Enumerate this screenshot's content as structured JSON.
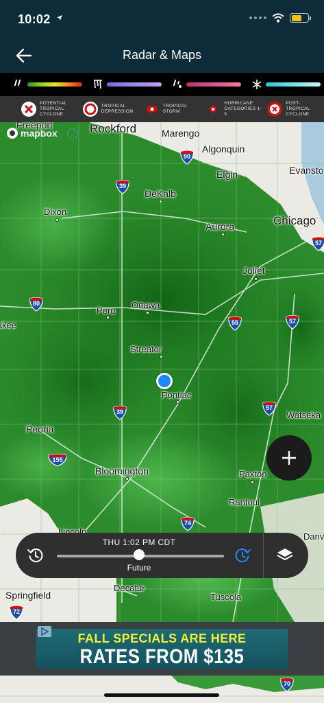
{
  "status_bar": {
    "time": "10:02"
  },
  "header": {
    "title": "Radar & Maps"
  },
  "precip_legend": {
    "items": [
      {
        "icon": "rain-icon",
        "colors": [
          "#1e9e1e",
          "#e8e82a",
          "#e02020"
        ]
      },
      {
        "icon": "ice-icon",
        "colors": [
          "#7a6cd6",
          "#c0a0f0"
        ]
      },
      {
        "icon": "mix-icon",
        "colors": [
          "#c03070",
          "#f07aa8"
        ]
      },
      {
        "icon": "snow-icon",
        "colors": [
          "#28c7d6",
          "#c8f6fa"
        ]
      }
    ]
  },
  "storm_legend": {
    "items": [
      {
        "icon": "potential-tropical-cyclone-icon",
        "label": "Potential Tropical Cyclone"
      },
      {
        "icon": "tropical-depression-icon",
        "label": "Tropical Depression"
      },
      {
        "icon": "tropical-storm-icon",
        "label": "Tropical Storm"
      },
      {
        "icon": "hurricane-icon",
        "label": "Hurricane Categories 1-5"
      },
      {
        "icon": "post-tropical-cyclone-icon",
        "label": "Post-Tropical Cyclone"
      }
    ]
  },
  "map": {
    "attribution": "mapbox",
    "cities": [
      {
        "name": "Freeport"
      },
      {
        "name": "Rockford"
      },
      {
        "name": "Marengo"
      },
      {
        "name": "Algonquin"
      },
      {
        "name": "Elgin"
      },
      {
        "name": "Evanston"
      },
      {
        "name": "DeKalb"
      },
      {
        "name": "Dixon"
      },
      {
        "name": "Aurora"
      },
      {
        "name": "Chicago"
      },
      {
        "name": "Joliet"
      },
      {
        "name": "Ottawa"
      },
      {
        "name": "Peru"
      },
      {
        "name": "Streator"
      },
      {
        "name": "Pontiac"
      },
      {
        "name": "Kankakee"
      },
      {
        "name": "Watseka"
      },
      {
        "name": "Peoria"
      },
      {
        "name": "Bloomington"
      },
      {
        "name": "Paxton"
      },
      {
        "name": "Rantoul"
      },
      {
        "name": "Lincoln"
      },
      {
        "name": "Danville"
      },
      {
        "name": "Springfield"
      },
      {
        "name": "Decatur"
      },
      {
        "name": "Tuscola"
      }
    ],
    "highways": [
      "90",
      "39",
      "80",
      "55",
      "57",
      "57",
      "39",
      "155",
      "74",
      "72",
      "70",
      "57"
    ]
  },
  "timeline": {
    "time": "THU 1:02 PM CDT",
    "mode": "Future",
    "progress": 0.49
  },
  "ad": {
    "line1": "FALL SPECIALS ARE HERE",
    "line2": "RATES FROM $135"
  }
}
